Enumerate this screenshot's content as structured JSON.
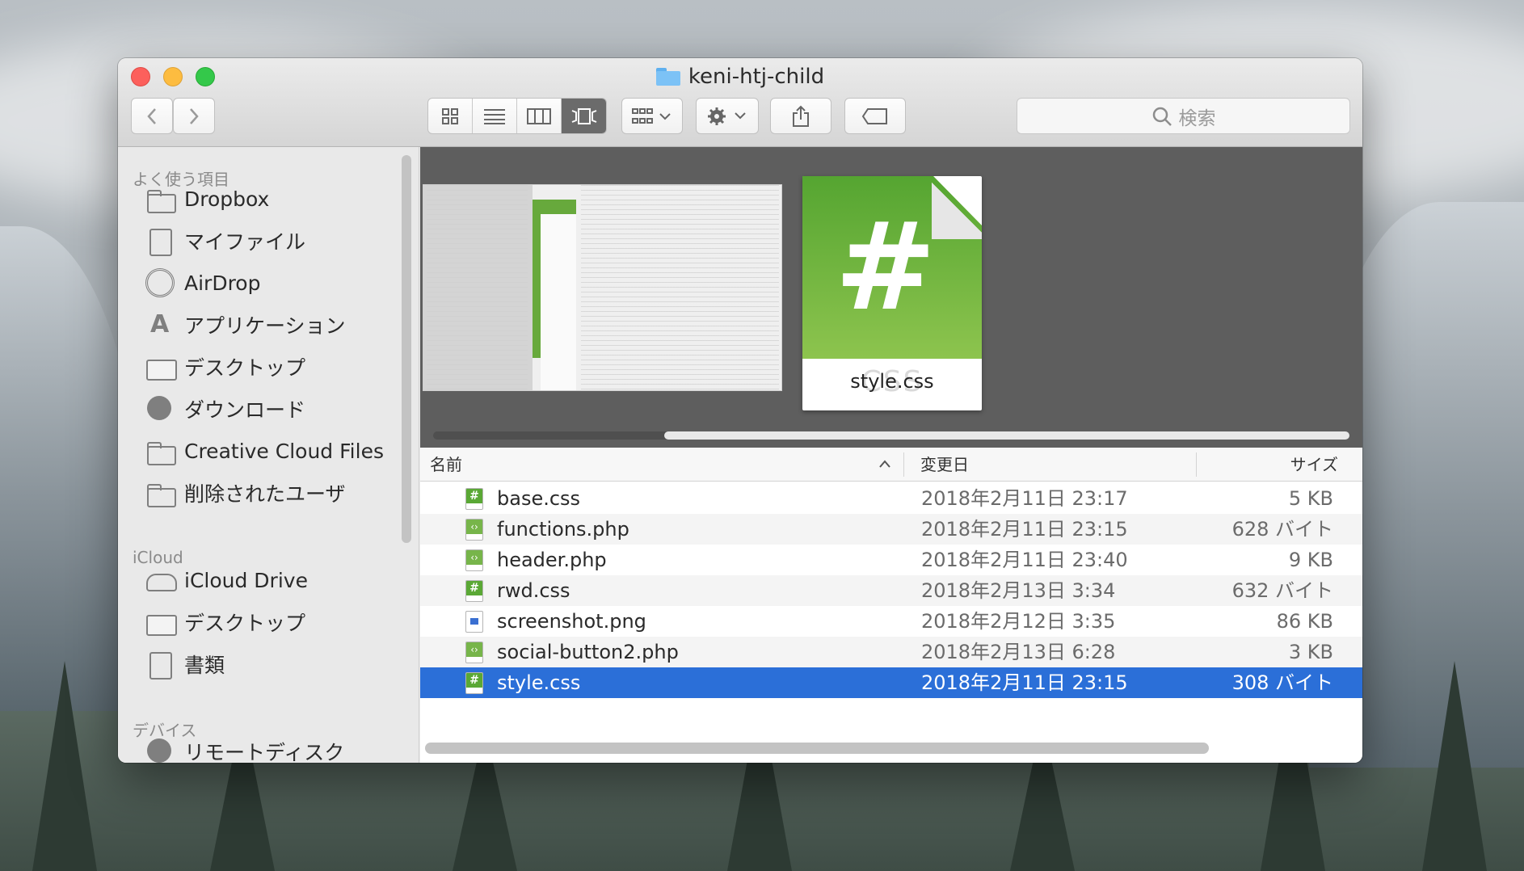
{
  "window": {
    "title": "keni-htj-child"
  },
  "toolbar": {
    "back_icon": "chevron-left-icon",
    "forward_icon": "chevron-right-icon",
    "view_modes": [
      "icon-view",
      "list-view",
      "column-view",
      "coverflow-view"
    ],
    "active_view": "coverflow-view",
    "search_placeholder": "検索"
  },
  "sidebar": {
    "sections": [
      {
        "heading": "よく使う項目",
        "items": [
          {
            "label": "Dropbox",
            "icon": "folder-icon"
          },
          {
            "label": "マイファイル",
            "icon": "all-files-icon"
          },
          {
            "label": "AirDrop",
            "icon": "airdrop-icon"
          },
          {
            "label": "アプリケーション",
            "icon": "applications-icon"
          },
          {
            "label": "デスクトップ",
            "icon": "desktop-icon"
          },
          {
            "label": "ダウンロード",
            "icon": "download-icon"
          },
          {
            "label": "Creative Cloud Files",
            "icon": "folder-icon"
          },
          {
            "label": "削除されたユーザ",
            "icon": "folder-icon"
          }
        ]
      },
      {
        "heading": "iCloud",
        "items": [
          {
            "label": "iCloud Drive",
            "icon": "cloud-icon"
          },
          {
            "label": "デスクトップ",
            "icon": "desktop-icon"
          },
          {
            "label": "書類",
            "icon": "documents-icon"
          }
        ]
      },
      {
        "heading": "デバイス",
        "items": [
          {
            "label": "リモートディスク",
            "icon": "remote-disc-icon"
          }
        ]
      }
    ]
  },
  "coverflow": {
    "selected_label": "style.css",
    "selected_ext_ghost": "CSS"
  },
  "list": {
    "columns": {
      "name": "名前",
      "date": "変更日",
      "size": "サイズ"
    },
    "rows": [
      {
        "name": "base.css",
        "date": "2018年2月11日 23:17",
        "size": "5 KB",
        "type": "css"
      },
      {
        "name": "functions.php",
        "date": "2018年2月11日 23:15",
        "size": "628 バイト",
        "type": "php"
      },
      {
        "name": "header.php",
        "date": "2018年2月11日 23:40",
        "size": "9 KB",
        "type": "php"
      },
      {
        "name": "rwd.css",
        "date": "2018年2月13日 3:34",
        "size": "632 バイト",
        "type": "css"
      },
      {
        "name": "screenshot.png",
        "date": "2018年2月12日 3:35",
        "size": "86 KB",
        "type": "png"
      },
      {
        "name": "social-button2.php",
        "date": "2018年2月13日 6:28",
        "size": "3 KB",
        "type": "php"
      },
      {
        "name": "style.css",
        "date": "2018年2月11日 23:15",
        "size": "308 バイト",
        "type": "css",
        "selected": true
      }
    ]
  },
  "colors": {
    "selection": "#2b6fd8",
    "css_green": "#5aa835"
  }
}
